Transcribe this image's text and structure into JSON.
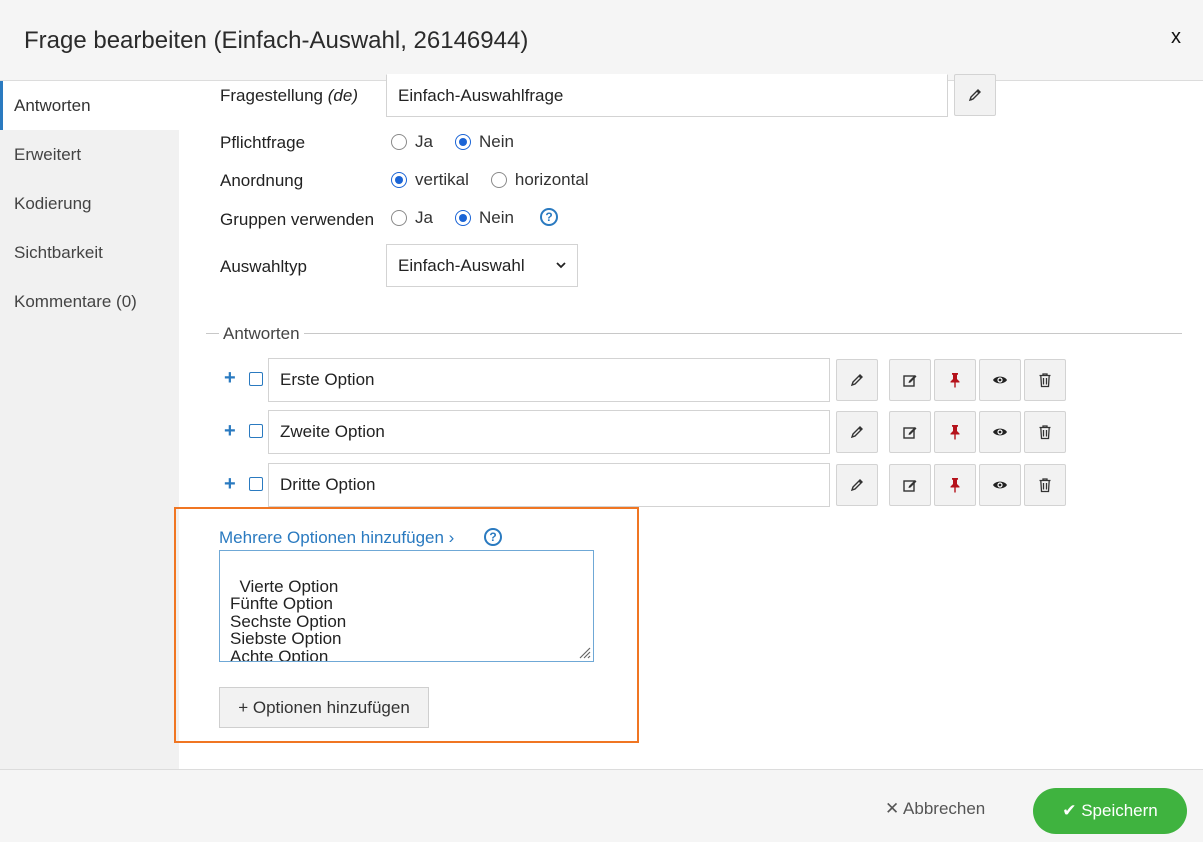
{
  "dialog": {
    "title": "Frage bearbeiten (Einfach-Auswahl, 26146944)",
    "close_label": "x"
  },
  "sidebar": {
    "items": [
      {
        "label": "Antworten",
        "active": true
      },
      {
        "label": "Erweitert"
      },
      {
        "label": "Kodierung"
      },
      {
        "label": "Sichtbarkeit"
      },
      {
        "label": "Kommentare (0)"
      }
    ]
  },
  "form": {
    "question_label": "Fragestellung",
    "question_lang": "(de)",
    "question_value": "Einfach-Auswahlfrage",
    "required_label": "Pflichtfrage",
    "required_options": [
      "Ja",
      "Nein"
    ],
    "required_selected": "Nein",
    "layout_label": "Anordnung",
    "layout_options": [
      "vertikal",
      "horizontal"
    ],
    "layout_selected": "vertikal",
    "groups_label": "Gruppen verwenden",
    "groups_options": [
      "Ja",
      "Nein"
    ],
    "groups_selected": "Nein",
    "help_glyph": "?",
    "type_label": "Auswahltyp",
    "type_value": "Einfach-Auswahl"
  },
  "answers": {
    "legend": "Antworten",
    "options": [
      "Erste Option",
      "Zweite Option",
      "Dritte Option"
    ],
    "plus_glyph": "+"
  },
  "bulk": {
    "link_label": "Mehrere Optionen hinzufügen ›",
    "textarea_value": "Vierte Option\nFünfte Option\nSechste Option\nSiebste Option\nAchte Option",
    "add_button_label": "+ Optionen hinzufügen"
  },
  "footer": {
    "cancel_label": "✕ Abbrechen",
    "save_label": "✔ Speichern"
  },
  "colors": {
    "accent": "#2a7ac0",
    "highlight": "#f07623",
    "save": "#3fb33f",
    "pin": "#b5121b"
  },
  "icons": {
    "translate": "pencil-icon",
    "edit": "edit-icon",
    "pin": "pin-icon",
    "visibility": "eye-icon",
    "delete": "trash-icon"
  }
}
